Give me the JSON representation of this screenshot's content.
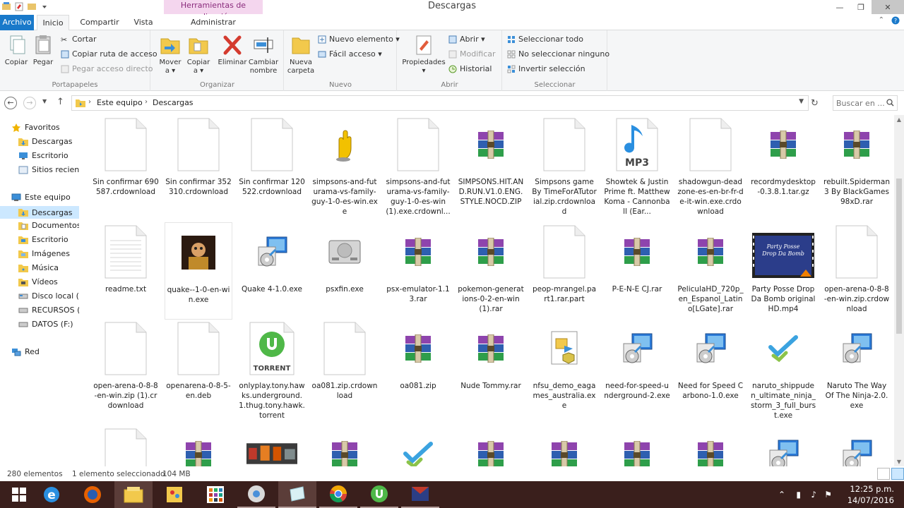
{
  "window": {
    "title": "Descargas",
    "context_tab_title": "Herramientas de aplicación",
    "minimize": "—",
    "maximize": "❐",
    "close": "✕"
  },
  "tabs": {
    "archivo": "Archivo",
    "inicio": "Inicio",
    "compartir": "Compartir",
    "vista": "Vista",
    "administrar": "Administrar"
  },
  "ribbon": {
    "portapapeles": {
      "label": "Portapapeles",
      "copiar": "Copiar",
      "pegar": "Pegar",
      "cortar": "Cortar",
      "copiar_ruta": "Copiar ruta de acceso",
      "pegar_acceso": "Pegar acceso directo"
    },
    "organizar": {
      "label": "Organizar",
      "mover": "Mover",
      "copiar": "Copiar",
      "eliminar": "Eliminar",
      "cambiar": "Cambiar",
      "nombre": "nombre",
      "a": "a ▾"
    },
    "nuevo": {
      "label": "Nuevo",
      "nueva": "Nueva",
      "carpeta": "carpeta",
      "nuevo_elemento": "Nuevo elemento ▾",
      "facil_acceso": "Fácil acceso ▾"
    },
    "abrir": {
      "label": "Abrir",
      "propiedades": "Propiedades",
      "abrir": "Abrir ▾",
      "modificar": "Modificar",
      "historial": "Historial"
    },
    "seleccionar": {
      "label": "Seleccionar",
      "todo": "Seleccionar todo",
      "ninguno": "No seleccionar ninguno",
      "invertir": "Invertir selección"
    }
  },
  "address": {
    "crumbs": [
      "Este equipo",
      "Descargas"
    ],
    "search_placeholder": "Buscar en ..."
  },
  "nav": {
    "favoritos": "Favoritos",
    "descargas": "Descargas",
    "escritorio": "Escritorio",
    "sitios": "Sitios recient",
    "este_equipo": "Este equipo",
    "descargas2": "Descargas",
    "documentos": "Documentos",
    "escritorio2": "Escritorio",
    "imagenes": "Imágenes",
    "musica": "Música",
    "videos": "Vídeos",
    "disco_local": "Disco local (C",
    "recursos": "RECURSOS (D",
    "datos": "DATOS (F:)",
    "red": "Red"
  },
  "files": [
    {
      "name": "Sin confirmar 690587.crdownload",
      "icon": "blank-file-icon"
    },
    {
      "name": "Sin confirmar 352310.crdownload",
      "icon": "blank-file-icon"
    },
    {
      "name": "Sin confirmar 120522.crdownload",
      "icon": "blank-file-icon"
    },
    {
      "name": "simpsons-and-futurama-vs-family-guy-1-0-es-win.exe",
      "icon": "glove-app-icon"
    },
    {
      "name": "simpsons-and-futurama-vs-family-guy-1-0-es-win (1).exe.crdownl...",
      "icon": "blank-file-icon"
    },
    {
      "name": "SIMPSONS.HIT.AND.RUN.V1.0.ENG.STYLE.NOCD.ZIP",
      "icon": "rar-archive-icon"
    },
    {
      "name": "Simpsons game By TimeForATutorial.zip.crdownload",
      "icon": "blank-file-icon"
    },
    {
      "name": "Showtek & Justin Prime ft. Matthew Koma - Cannonball (Ear...",
      "icon": "mp3-file-icon"
    },
    {
      "name": "shadowgun-deadzone-es-en-br-fr-de-it-win.exe.crdownload",
      "icon": "blank-file-icon"
    },
    {
      "name": "recordmydesktop-0.3.8.1.tar.gz",
      "icon": "rar-archive-icon"
    },
    {
      "name": "rebuilt.Spiderman 3 By BlackGames98xD.rar",
      "icon": "rar-archive-icon"
    },
    {
      "name": "readme.txt",
      "icon": "text-file-icon"
    },
    {
      "name": "quake--1-0-en-win.exe",
      "icon": "quake-app-icon"
    },
    {
      "name": "Quake 4-1.0.exe",
      "icon": "installer-icon"
    },
    {
      "name": "psxfin.exe",
      "icon": "psx-console-icon"
    },
    {
      "name": "psx-emulator-1.13.rar",
      "icon": "rar-archive-icon"
    },
    {
      "name": "pokemon-generations-0-2-en-win (1).rar",
      "icon": "rar-archive-icon"
    },
    {
      "name": "peop-mrangel.part1.rar.part",
      "icon": "blank-file-icon"
    },
    {
      "name": "P-E-N-E CJ.rar",
      "icon": "rar-archive-icon"
    },
    {
      "name": "PeliculaHD_720p_en_Espanol_Latino[LGate].rar",
      "icon": "rar-archive-icon"
    },
    {
      "name": "Party Posse Drop Da Bomb original HD.mp4",
      "icon": "video-thumbnail-icon",
      "thumb_text": "Party Posse Drop Da Bomb"
    },
    {
      "name": "open-arena-0-8-8-en-win.zip.crdownload",
      "icon": "blank-file-icon"
    },
    {
      "name": "open-arena-0-8-8-en-win.zip (1).crdownload",
      "icon": "blank-file-icon"
    },
    {
      "name": "openarena-0-8-5-en.deb",
      "icon": "blank-file-icon"
    },
    {
      "name": "onlyplay.tony.hawks.underground.1.thug.tony.hawk.torrent",
      "icon": "torrent-file-icon",
      "badge": "TORRENT"
    },
    {
      "name": "oa081.zip.crdownload",
      "icon": "blank-file-icon"
    },
    {
      "name": "oa081.zip",
      "icon": "rar-archive-icon"
    },
    {
      "name": "Nude Tommy.rar",
      "icon": "rar-archive-icon"
    },
    {
      "name": "nfsu_demo_eagames_australia.exe",
      "icon": "setup-icon"
    },
    {
      "name": "need-for-speed-underground-2.exe",
      "icon": "installer-icon"
    },
    {
      "name": "Need for Speed Carbono-1.0.exe",
      "icon": "installer-icon"
    },
    {
      "name": "naruto_shippuden_ultimate_ninja_storm_3_full_burst.exe",
      "icon": "checkmark-app-icon"
    },
    {
      "name": "Naruto The Way Of The Ninja-2.0.exe",
      "icon": "installer-icon"
    },
    {
      "name": "",
      "icon": "blank-file-icon"
    },
    {
      "name": "",
      "icon": "rar-archive-icon"
    },
    {
      "name": "",
      "icon": "photo-thumbnail-icon"
    },
    {
      "name": "",
      "icon": "rar-archive-icon"
    },
    {
      "name": "",
      "icon": "checkmark-app-icon"
    },
    {
      "name": "",
      "icon": "rar-archive-icon"
    },
    {
      "name": "",
      "icon": "rar-archive-icon"
    },
    {
      "name": "",
      "icon": "rar-archive-icon"
    },
    {
      "name": "",
      "icon": "rar-archive-icon"
    },
    {
      "name": "",
      "icon": "installer-icon"
    },
    {
      "name": "",
      "icon": "installer-icon"
    }
  ],
  "status": {
    "count": "280 elementos",
    "selected": "1 elemento seleccionado",
    "size": "104 MB"
  },
  "tray": {
    "time": "12:25 p.m.",
    "date": "14/07/2016"
  }
}
